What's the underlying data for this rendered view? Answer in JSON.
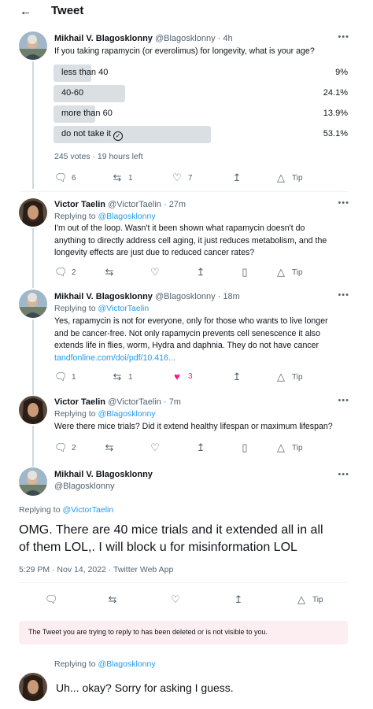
{
  "header": {
    "title": "Tweet"
  },
  "tweet1": {
    "name": "Mikhail V. Blagosklonny",
    "handle": "@Blagosklonny",
    "time": "· 4h",
    "text": "If you taking rapamycin (or everolimus) for longevity, what is your age?",
    "poll": {
      "options": [
        {
          "label": "less than 40",
          "pct": "9%",
          "fraction": 0.09
        },
        {
          "label": "40-60",
          "pct": "24.1%",
          "fraction": 0.241
        },
        {
          "label": "more than 60",
          "pct": "13.9%",
          "fraction": 0.139
        },
        {
          "label": "do not take it",
          "pct": "53.1%",
          "fraction": 0.531
        }
      ],
      "footer": "245 votes · 19 hours left"
    },
    "actions": {
      "replies": "6",
      "retweets": "1",
      "likes": "7",
      "tip": "Tip"
    }
  },
  "tweet2": {
    "name": "Victor Taelin",
    "handle": "@VictorTaelin",
    "time": "· 27m",
    "replying_prefix": "Replying to ",
    "replying_to": "@Blagosklonny",
    "text_lines": [
      "I'm out of the loop. Wasn't it been shown what rapamycin doesn't do",
      "anything to directly address cell aging, it just reduces metabolism, and the",
      "longevity effects are just due to reduced cancer rates?"
    ],
    "actions": {
      "replies": "2",
      "tip": "Tip"
    }
  },
  "tweet3": {
    "name": "Mikhail V. Blagosklonny",
    "handle": "@Blagosklonny",
    "time": "· 18m",
    "replying_prefix": "Replying to ",
    "replying_to": "@VictorTaelin",
    "text_lines": [
      "Yes, rapamycin is not for everyone, only for those who wants to live longer",
      "and be cancer-free. Not only rapamycin prevents cell senescence it also",
      "extends life in flies, worm, Hydra and daphnia. They do not have cancer"
    ],
    "link": "tandfonline.com/doi/pdf/10.416...",
    "actions": {
      "replies": "1",
      "retweets": "1",
      "likes": "3",
      "tip": "Tip"
    }
  },
  "tweet4": {
    "name": "Victor Taelin",
    "handle": "@VictorTaelin",
    "time": "· 7m",
    "replying_prefix": "Replying to ",
    "replying_to": "@Blagosklonny",
    "text": "Were there mice trials? Did it extend healthy lifespan or maximum lifespan?",
    "actions": {
      "replies": "2",
      "tip": "Tip"
    }
  },
  "main_tweet": {
    "name": "Mikhail V. Blagosklonny",
    "handle": "@Blagosklonny",
    "replying_prefix": "Replying to ",
    "replying_to": "@VictorTaelin",
    "text_lines": [
      "OMG. There are 40 mice trials and it extended all in all",
      "of them LOL,. I will block u for misinformation LOL"
    ],
    "meta": "5:29 PM · Nov 14, 2022 · Twitter Web App",
    "actions": {
      "tip": "Tip"
    }
  },
  "notice": "The Tweet you are trying to reply to has been deleted or is not visible to you.",
  "reply": {
    "replying_prefix": "Replying to ",
    "replying_to": "@Blagosklonny",
    "text": "Uh... okay? Sorry for asking I guess."
  },
  "colors": {
    "accent": "#1d9bf0",
    "like": "#f91880",
    "poll_bar": "#d9dfe3",
    "notice_bg": "#fdeff1"
  }
}
